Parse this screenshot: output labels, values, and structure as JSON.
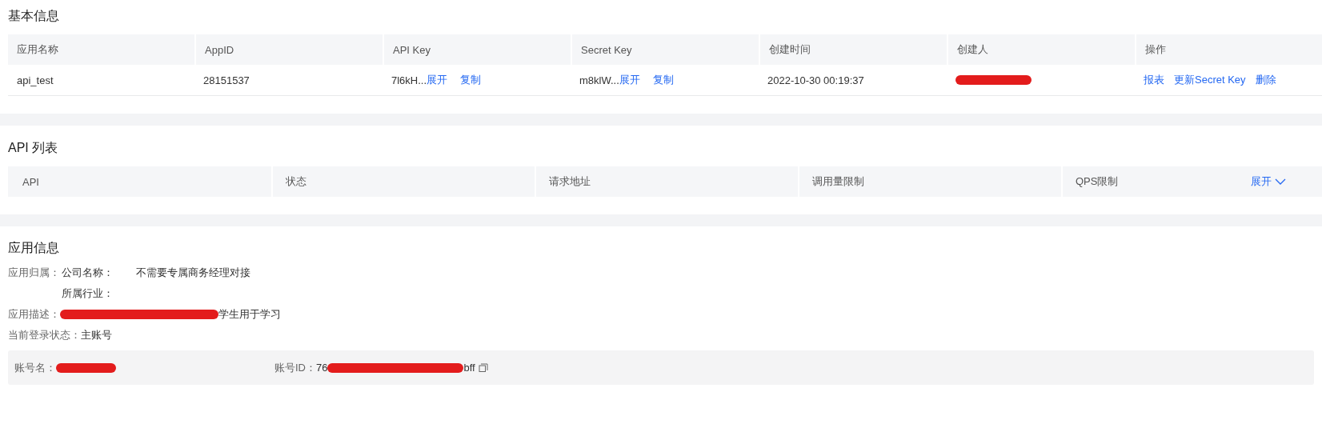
{
  "basic_info": {
    "title": "基本信息",
    "columns": [
      "应用名称",
      "AppID",
      "API Key",
      "Secret Key",
      "创建时间",
      "创建人",
      "操作"
    ],
    "rows": [
      {
        "app_name": "api_test",
        "app_id": "28151537",
        "api_key": {
          "value": "7l6kH...",
          "links": [
            "展开",
            "复制"
          ]
        },
        "secret_key": {
          "value": "m8klW...",
          "links": [
            "展开",
            "复制"
          ]
        },
        "created": "2022-10-30 00:19:37",
        "creator": {
          "kind": "redacted"
        },
        "actions": [
          "报表",
          "更新Secret Key",
          "删除"
        ]
      }
    ]
  },
  "api_list": {
    "title": "API 列表",
    "columns": [
      "API",
      "状态",
      "请求地址",
      "调用量限制",
      "QPS限制"
    ],
    "expand": "展开"
  },
  "app_info": {
    "title": "应用信息",
    "owner_label": "应用归属：",
    "company_label": "公司名称：",
    "company_value": "不需要专属商务经理对接",
    "industry_label": "所属行业：",
    "description_label": "应用描述：",
    "description_visible": "学生用于学习",
    "login_label": "当前登录状态：",
    "login_value": "主账号",
    "account_name_label": "账号名：",
    "account_id_label": "账号ID：",
    "account_id_start": "76",
    "account_id_end": "bff"
  }
}
